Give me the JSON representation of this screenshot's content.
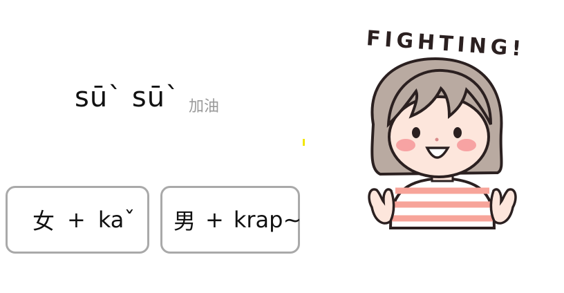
{
  "vocab": {
    "word": "sū` sū`",
    "meaning": "加油"
  },
  "endings": [
    {
      "glyph": "女",
      "plus": "+",
      "particle": "kaˇ"
    },
    {
      "glyph": "男",
      "plus": "+",
      "particle": "krap~"
    }
  ],
  "sticker": {
    "caption": "FIGHTING!",
    "colors": {
      "hair": "#b9aaa1",
      "skin": "#fde6dc",
      "shirt_stripe": "#f7a49a",
      "cheek": "#f7a3a3",
      "outline": "#2b2020"
    }
  }
}
